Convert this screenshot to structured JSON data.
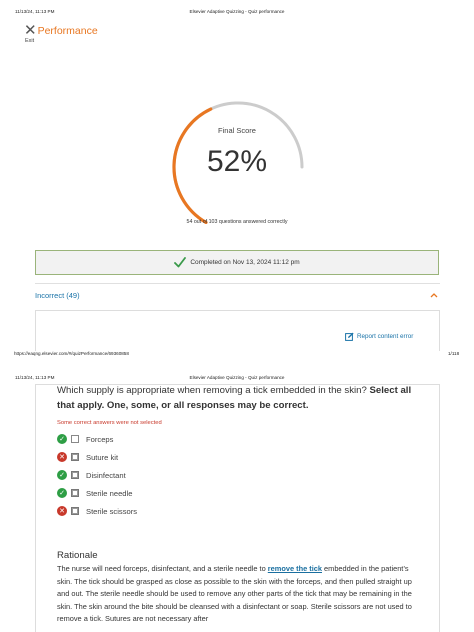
{
  "print_header_1": {
    "datetime": "11/13/24, 11:13 PM",
    "page_title": "Elsevier Adaptive Quizzing - Quiz performance"
  },
  "header": {
    "title": "Performance",
    "exit_label": "Exit"
  },
  "score": {
    "label": "Final Score",
    "percent": 52,
    "percent_text": "52%",
    "answered_text": "54 out of 103 questions answered correctly",
    "arc_color": "#e87722",
    "track_color": "#cccccc"
  },
  "completed": {
    "text": "Completed on Nov 13, 2024 11:12 pm"
  },
  "section": {
    "label": "Incorrect (49)",
    "report_label": "Report content error"
  },
  "print_footer": {
    "url": "https://eaqng.elsevier.com/#/quizPerformance/69360858",
    "page": "1/118"
  },
  "print_header_2": {
    "datetime": "11/13/24, 11:13 PM",
    "page_title": "Elsevier Adaptive Quizzing - Quiz performance"
  },
  "question": {
    "text": "Which supply is appropriate when removing a tick embedded in the skin?",
    "instruction": "Select all that apply. One, some, or all responses may be correct.",
    "feedback": "Some correct answers were not selected",
    "options": [
      {
        "label": "Forceps",
        "status": "correct",
        "selected": false
      },
      {
        "label": "Suture kit",
        "status": "incorrect",
        "selected": true
      },
      {
        "label": "Disinfectant",
        "status": "correct",
        "selected": true
      },
      {
        "label": "Sterile needle",
        "status": "correct",
        "selected": true
      },
      {
        "label": "Sterile scissors",
        "status": "incorrect",
        "selected": true
      }
    ]
  },
  "rationale": {
    "heading": "Rationale",
    "before_link": "The nurse will need forceps, disinfectant, and a sterile needle to ",
    "link": "remove the tick",
    "after_link": " embedded in the patient’s skin. The tick should be grasped as close as possible to the skin with the forceps, and then pulled straight up and out. The sterile needle should be used to remove any other parts of the tick that may be remaining in the skin. The skin around the bite should be cleansed with a disinfectant or soap. Sterile scissors are not used to remove a tick. Sutures are not necessary after"
  }
}
